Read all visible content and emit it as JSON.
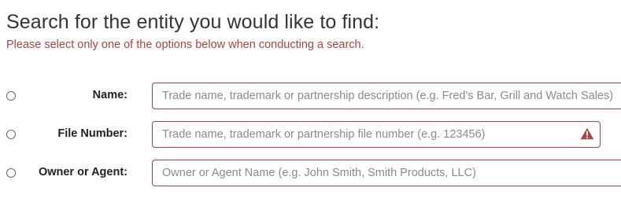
{
  "heading": "Search for the entity you would like to find:",
  "instruction": "Please select only one of the options below when conducting a search.",
  "fields": [
    {
      "label": "Name:",
      "placeholder": "Trade name, trademark or partnership description (e.g. Fred's Bar, Grill and Watch Sales)",
      "value": "",
      "selected": false
    },
    {
      "label": "File Number:",
      "placeholder": "Trade name, trademark or partnership file number (e.g. 123456)",
      "value": "",
      "selected": false,
      "icon": "warning-icon"
    },
    {
      "label": "Owner or Agent:",
      "placeholder": "Owner or Agent Name (e.g. John Smith, Smith Products, LLC)",
      "value": "",
      "selected": false
    }
  ],
  "colors": {
    "error": "#a94442",
    "heading": "#333333",
    "label": "#222222",
    "placeholder": "#8a8a8a"
  }
}
